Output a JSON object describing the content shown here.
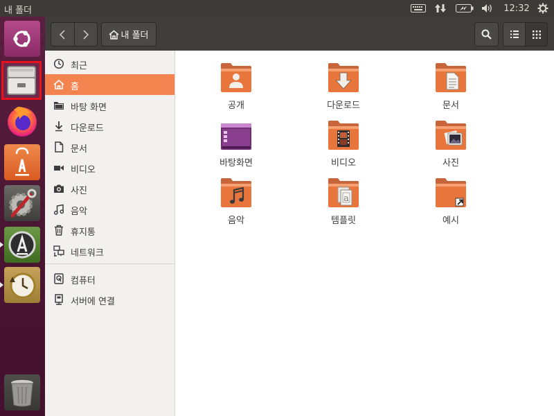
{
  "topbar": {
    "window_title": "내 폴더",
    "clock": "12:32"
  },
  "launcher": {
    "items": [
      {
        "name": "dash",
        "icon": "ubuntu-logo-icon"
      },
      {
        "name": "files",
        "icon": "file-cabinet-icon",
        "highlighted": true
      },
      {
        "name": "firefox",
        "icon": "firefox-icon"
      },
      {
        "name": "software-center",
        "icon": "shopping-bag-icon"
      },
      {
        "name": "system-settings",
        "icon": "wrench-gear-icon"
      },
      {
        "name": "software-updater",
        "icon": "updater-icon"
      },
      {
        "name": "backups",
        "icon": "clock-icon"
      },
      {
        "name": "trash",
        "icon": "trash-icon"
      }
    ]
  },
  "headerbar": {
    "path_label": "내 폴더"
  },
  "sidebar": {
    "places": [
      {
        "label": "최근",
        "icon": "clock-icon"
      },
      {
        "label": "홈",
        "icon": "home-icon",
        "active": true
      },
      {
        "label": "바탕 화면",
        "icon": "folder-icon"
      },
      {
        "label": "다운로드",
        "icon": "download-icon"
      },
      {
        "label": "문서",
        "icon": "document-icon"
      },
      {
        "label": "비디오",
        "icon": "video-icon"
      },
      {
        "label": "사진",
        "icon": "camera-icon"
      },
      {
        "label": "음악",
        "icon": "music-icon"
      },
      {
        "label": "휴지통",
        "icon": "trash-icon"
      },
      {
        "label": "네트워크",
        "icon": "network-icon"
      }
    ],
    "devices": [
      {
        "label": "컴퓨터",
        "icon": "drive-icon"
      },
      {
        "label": "서버에 연결",
        "icon": "server-icon"
      }
    ]
  },
  "content": {
    "folders": [
      {
        "label": "공개",
        "icon": "public-folder-icon"
      },
      {
        "label": "다운로드",
        "icon": "download-folder-icon"
      },
      {
        "label": "문서",
        "icon": "documents-folder-icon"
      },
      {
        "label": "바탕화면",
        "icon": "desktop-folder-icon"
      },
      {
        "label": "비디오",
        "icon": "videos-folder-icon"
      },
      {
        "label": "사진",
        "icon": "pictures-folder-icon"
      },
      {
        "label": "음악",
        "icon": "music-folder-icon"
      },
      {
        "label": "템플릿",
        "icon": "templates-folder-icon"
      },
      {
        "label": "예시",
        "icon": "examples-folder-icon"
      }
    ]
  },
  "colors": {
    "accent": "#f3834f",
    "launcher": "#4b1634",
    "headerbar": "#3f3e3b",
    "folder": "#e8763c"
  }
}
